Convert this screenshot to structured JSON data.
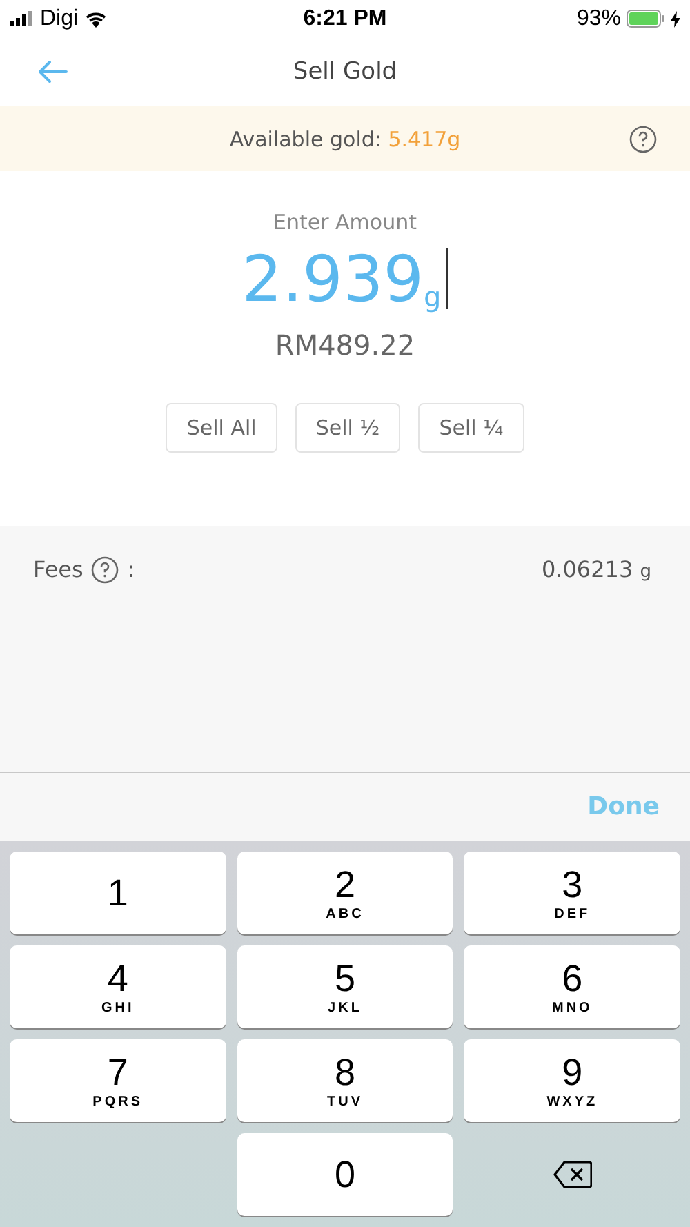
{
  "status_bar": {
    "carrier": "Digi",
    "time": "6:21 PM",
    "battery": "93%"
  },
  "nav": {
    "title": "Sell Gold"
  },
  "banner": {
    "label": "Available gold:",
    "value": "5.417g"
  },
  "amount": {
    "label": "Enter Amount",
    "value": "2.939",
    "unit": "g",
    "converted": "RM489.22"
  },
  "quick_buttons": [
    "Sell All",
    "Sell ½",
    "Sell ¼"
  ],
  "fees": {
    "label": "Fees",
    "separator": ":",
    "value": "0.06213",
    "unit": "g"
  },
  "toolbar": {
    "done": "Done"
  },
  "keypad": [
    {
      "kind": "digit",
      "digit": "1"
    },
    {
      "kind": "digit",
      "digit": "2",
      "letters": "ABC"
    },
    {
      "kind": "digit",
      "digit": "3",
      "letters": "DEF"
    },
    {
      "kind": "digit",
      "digit": "4",
      "letters": "GHI"
    },
    {
      "kind": "digit",
      "digit": "5",
      "letters": "JKL"
    },
    {
      "kind": "digit",
      "digit": "6",
      "letters": "MNO"
    },
    {
      "kind": "digit",
      "digit": "7",
      "letters": "PQRS"
    },
    {
      "kind": "digit",
      "digit": "8",
      "letters": "TUV"
    },
    {
      "kind": "digit",
      "digit": "9",
      "letters": "WXYZ"
    },
    {
      "kind": "empty"
    },
    {
      "kind": "digit",
      "digit": "0"
    },
    {
      "kind": "delete"
    }
  ]
}
